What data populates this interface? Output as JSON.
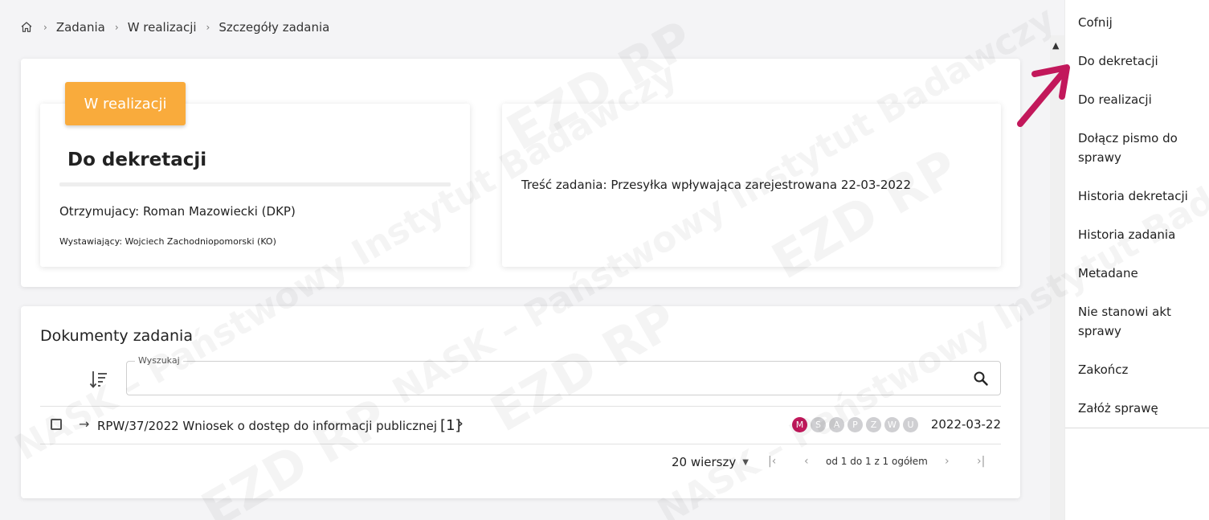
{
  "breadcrumb": {
    "items": [
      "Zadania",
      "W realizacji",
      "Szczegóły zadania"
    ]
  },
  "task": {
    "status": "W realizacji",
    "title": "Do dekretacji",
    "recipient": "Otrzymujacy: Roman Mazowiecki (DKP)",
    "issuer": "Wystawiający: Wojciech Zachodniopomorski (KO)",
    "content": "Treść zadania: Przesyłka wpływająca zarejestrowana 22-03-2022"
  },
  "documents": {
    "title": "Dokumenty zadania",
    "search_label": "Wyszukaj",
    "rows": [
      {
        "name": "RPW/37/2022 Wniosek o dostęp do informacji publicznej",
        "count": "[1]",
        "letters": [
          "M",
          "S",
          "A",
          "P",
          "Z",
          "W",
          "U"
        ],
        "active_letter": "M",
        "date": "2022-03-22"
      }
    ],
    "pager": {
      "rows_per_page": "20 wierszy",
      "info": "od 1 do 1 z 1 ogółem"
    }
  },
  "menu": {
    "items": [
      "Cofnij",
      "Do dekretacji",
      "Do realizacji",
      "Dołącz pismo do sprawy",
      "Historia dekretacji",
      "Historia zadania",
      "Metadane",
      "Nie stanowi akt sprawy",
      "Zakończ",
      "Załóż sprawę"
    ]
  },
  "watermark": {
    "text_1": "NASK – Państwowy Instytut Badawczy",
    "text_2": "EZD RP"
  },
  "colors": {
    "status_badge": "#f9ab3c",
    "active_letter": "#c2185b",
    "annotation_arrow": "#c2185b"
  }
}
